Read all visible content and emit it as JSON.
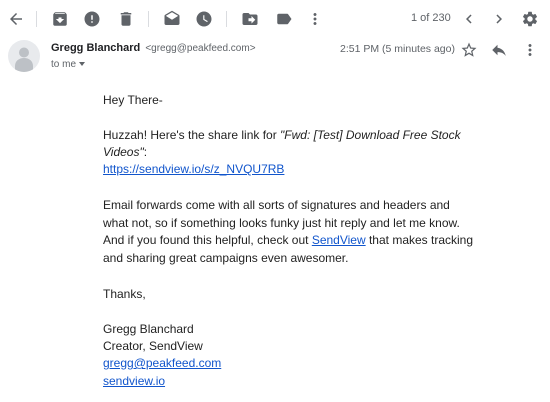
{
  "toolbar": {
    "icons": [
      "back-arrow-icon",
      "archive-icon",
      "report-spam-icon",
      "delete-icon",
      "mark-unread-icon",
      "snooze-icon",
      "move-to-icon",
      "label-icon",
      "more-vert-icon"
    ],
    "pager": "1 of 230"
  },
  "header": {
    "sender_name": "Gregg Blanchard",
    "sender_email": "<gregg@peakfeed.com>",
    "timestamp": "2:51 PM (5 minutes ago)",
    "to_line": "to me"
  },
  "body": {
    "greeting": "Hey There-",
    "intro_prefix": "Huzzah! Here's the share link for ",
    "intro_subject_1": "\"Fwd: [Test] Download Free Stock",
    "intro_subject_2": "Videos\"",
    "intro_colon": ":",
    "share_link": "https://sendview.io/s/z_NVQU7RB",
    "para2_line1": "Email forwards come with all sorts of signatures and headers and",
    "para2_line2": "what not, so if something looks funky just hit reply and let me know.",
    "para2_line3_prefix": "And if you found this helpful, check out ",
    "para2_link": "SendView",
    "para2_line3_suffix": " that makes tracking",
    "para2_line4": "and sharing great campaigns even awesomer.",
    "thanks": "Thanks,",
    "sig_name": "Gregg Blanchard",
    "sig_title": "Creator, SendView",
    "sig_email": "gregg@peakfeed.com",
    "sig_site": "sendview.io"
  }
}
